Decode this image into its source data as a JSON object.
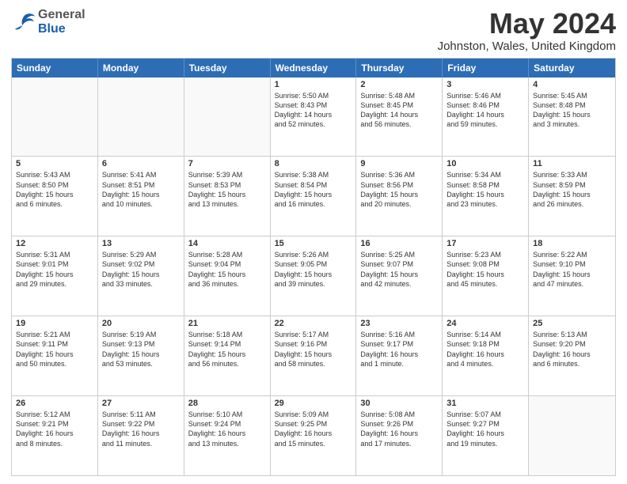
{
  "header": {
    "logo_general": "General",
    "logo_blue": "Blue",
    "title": "May 2024",
    "location": "Johnston, Wales, United Kingdom"
  },
  "weekdays": [
    "Sunday",
    "Monday",
    "Tuesday",
    "Wednesday",
    "Thursday",
    "Friday",
    "Saturday"
  ],
  "weeks": [
    [
      {
        "day": "",
        "info": ""
      },
      {
        "day": "",
        "info": ""
      },
      {
        "day": "",
        "info": ""
      },
      {
        "day": "1",
        "info": "Sunrise: 5:50 AM\nSunset: 8:43 PM\nDaylight: 14 hours\nand 52 minutes."
      },
      {
        "day": "2",
        "info": "Sunrise: 5:48 AM\nSunset: 8:45 PM\nDaylight: 14 hours\nand 56 minutes."
      },
      {
        "day": "3",
        "info": "Sunrise: 5:46 AM\nSunset: 8:46 PM\nDaylight: 14 hours\nand 59 minutes."
      },
      {
        "day": "4",
        "info": "Sunrise: 5:45 AM\nSunset: 8:48 PM\nDaylight: 15 hours\nand 3 minutes."
      }
    ],
    [
      {
        "day": "5",
        "info": "Sunrise: 5:43 AM\nSunset: 8:50 PM\nDaylight: 15 hours\nand 6 minutes."
      },
      {
        "day": "6",
        "info": "Sunrise: 5:41 AM\nSunset: 8:51 PM\nDaylight: 15 hours\nand 10 minutes."
      },
      {
        "day": "7",
        "info": "Sunrise: 5:39 AM\nSunset: 8:53 PM\nDaylight: 15 hours\nand 13 minutes."
      },
      {
        "day": "8",
        "info": "Sunrise: 5:38 AM\nSunset: 8:54 PM\nDaylight: 15 hours\nand 16 minutes."
      },
      {
        "day": "9",
        "info": "Sunrise: 5:36 AM\nSunset: 8:56 PM\nDaylight: 15 hours\nand 20 minutes."
      },
      {
        "day": "10",
        "info": "Sunrise: 5:34 AM\nSunset: 8:58 PM\nDaylight: 15 hours\nand 23 minutes."
      },
      {
        "day": "11",
        "info": "Sunrise: 5:33 AM\nSunset: 8:59 PM\nDaylight: 15 hours\nand 26 minutes."
      }
    ],
    [
      {
        "day": "12",
        "info": "Sunrise: 5:31 AM\nSunset: 9:01 PM\nDaylight: 15 hours\nand 29 minutes."
      },
      {
        "day": "13",
        "info": "Sunrise: 5:29 AM\nSunset: 9:02 PM\nDaylight: 15 hours\nand 33 minutes."
      },
      {
        "day": "14",
        "info": "Sunrise: 5:28 AM\nSunset: 9:04 PM\nDaylight: 15 hours\nand 36 minutes."
      },
      {
        "day": "15",
        "info": "Sunrise: 5:26 AM\nSunset: 9:05 PM\nDaylight: 15 hours\nand 39 minutes."
      },
      {
        "day": "16",
        "info": "Sunrise: 5:25 AM\nSunset: 9:07 PM\nDaylight: 15 hours\nand 42 minutes."
      },
      {
        "day": "17",
        "info": "Sunrise: 5:23 AM\nSunset: 9:08 PM\nDaylight: 15 hours\nand 45 minutes."
      },
      {
        "day": "18",
        "info": "Sunrise: 5:22 AM\nSunset: 9:10 PM\nDaylight: 15 hours\nand 47 minutes."
      }
    ],
    [
      {
        "day": "19",
        "info": "Sunrise: 5:21 AM\nSunset: 9:11 PM\nDaylight: 15 hours\nand 50 minutes."
      },
      {
        "day": "20",
        "info": "Sunrise: 5:19 AM\nSunset: 9:13 PM\nDaylight: 15 hours\nand 53 minutes."
      },
      {
        "day": "21",
        "info": "Sunrise: 5:18 AM\nSunset: 9:14 PM\nDaylight: 15 hours\nand 56 minutes."
      },
      {
        "day": "22",
        "info": "Sunrise: 5:17 AM\nSunset: 9:16 PM\nDaylight: 15 hours\nand 58 minutes."
      },
      {
        "day": "23",
        "info": "Sunrise: 5:16 AM\nSunset: 9:17 PM\nDaylight: 16 hours\nand 1 minute."
      },
      {
        "day": "24",
        "info": "Sunrise: 5:14 AM\nSunset: 9:18 PM\nDaylight: 16 hours\nand 4 minutes."
      },
      {
        "day": "25",
        "info": "Sunrise: 5:13 AM\nSunset: 9:20 PM\nDaylight: 16 hours\nand 6 minutes."
      }
    ],
    [
      {
        "day": "26",
        "info": "Sunrise: 5:12 AM\nSunset: 9:21 PM\nDaylight: 16 hours\nand 8 minutes."
      },
      {
        "day": "27",
        "info": "Sunrise: 5:11 AM\nSunset: 9:22 PM\nDaylight: 16 hours\nand 11 minutes."
      },
      {
        "day": "28",
        "info": "Sunrise: 5:10 AM\nSunset: 9:24 PM\nDaylight: 16 hours\nand 13 minutes."
      },
      {
        "day": "29",
        "info": "Sunrise: 5:09 AM\nSunset: 9:25 PM\nDaylight: 16 hours\nand 15 minutes."
      },
      {
        "day": "30",
        "info": "Sunrise: 5:08 AM\nSunset: 9:26 PM\nDaylight: 16 hours\nand 17 minutes."
      },
      {
        "day": "31",
        "info": "Sunrise: 5:07 AM\nSunset: 9:27 PM\nDaylight: 16 hours\nand 19 minutes."
      },
      {
        "day": "",
        "info": ""
      }
    ]
  ]
}
